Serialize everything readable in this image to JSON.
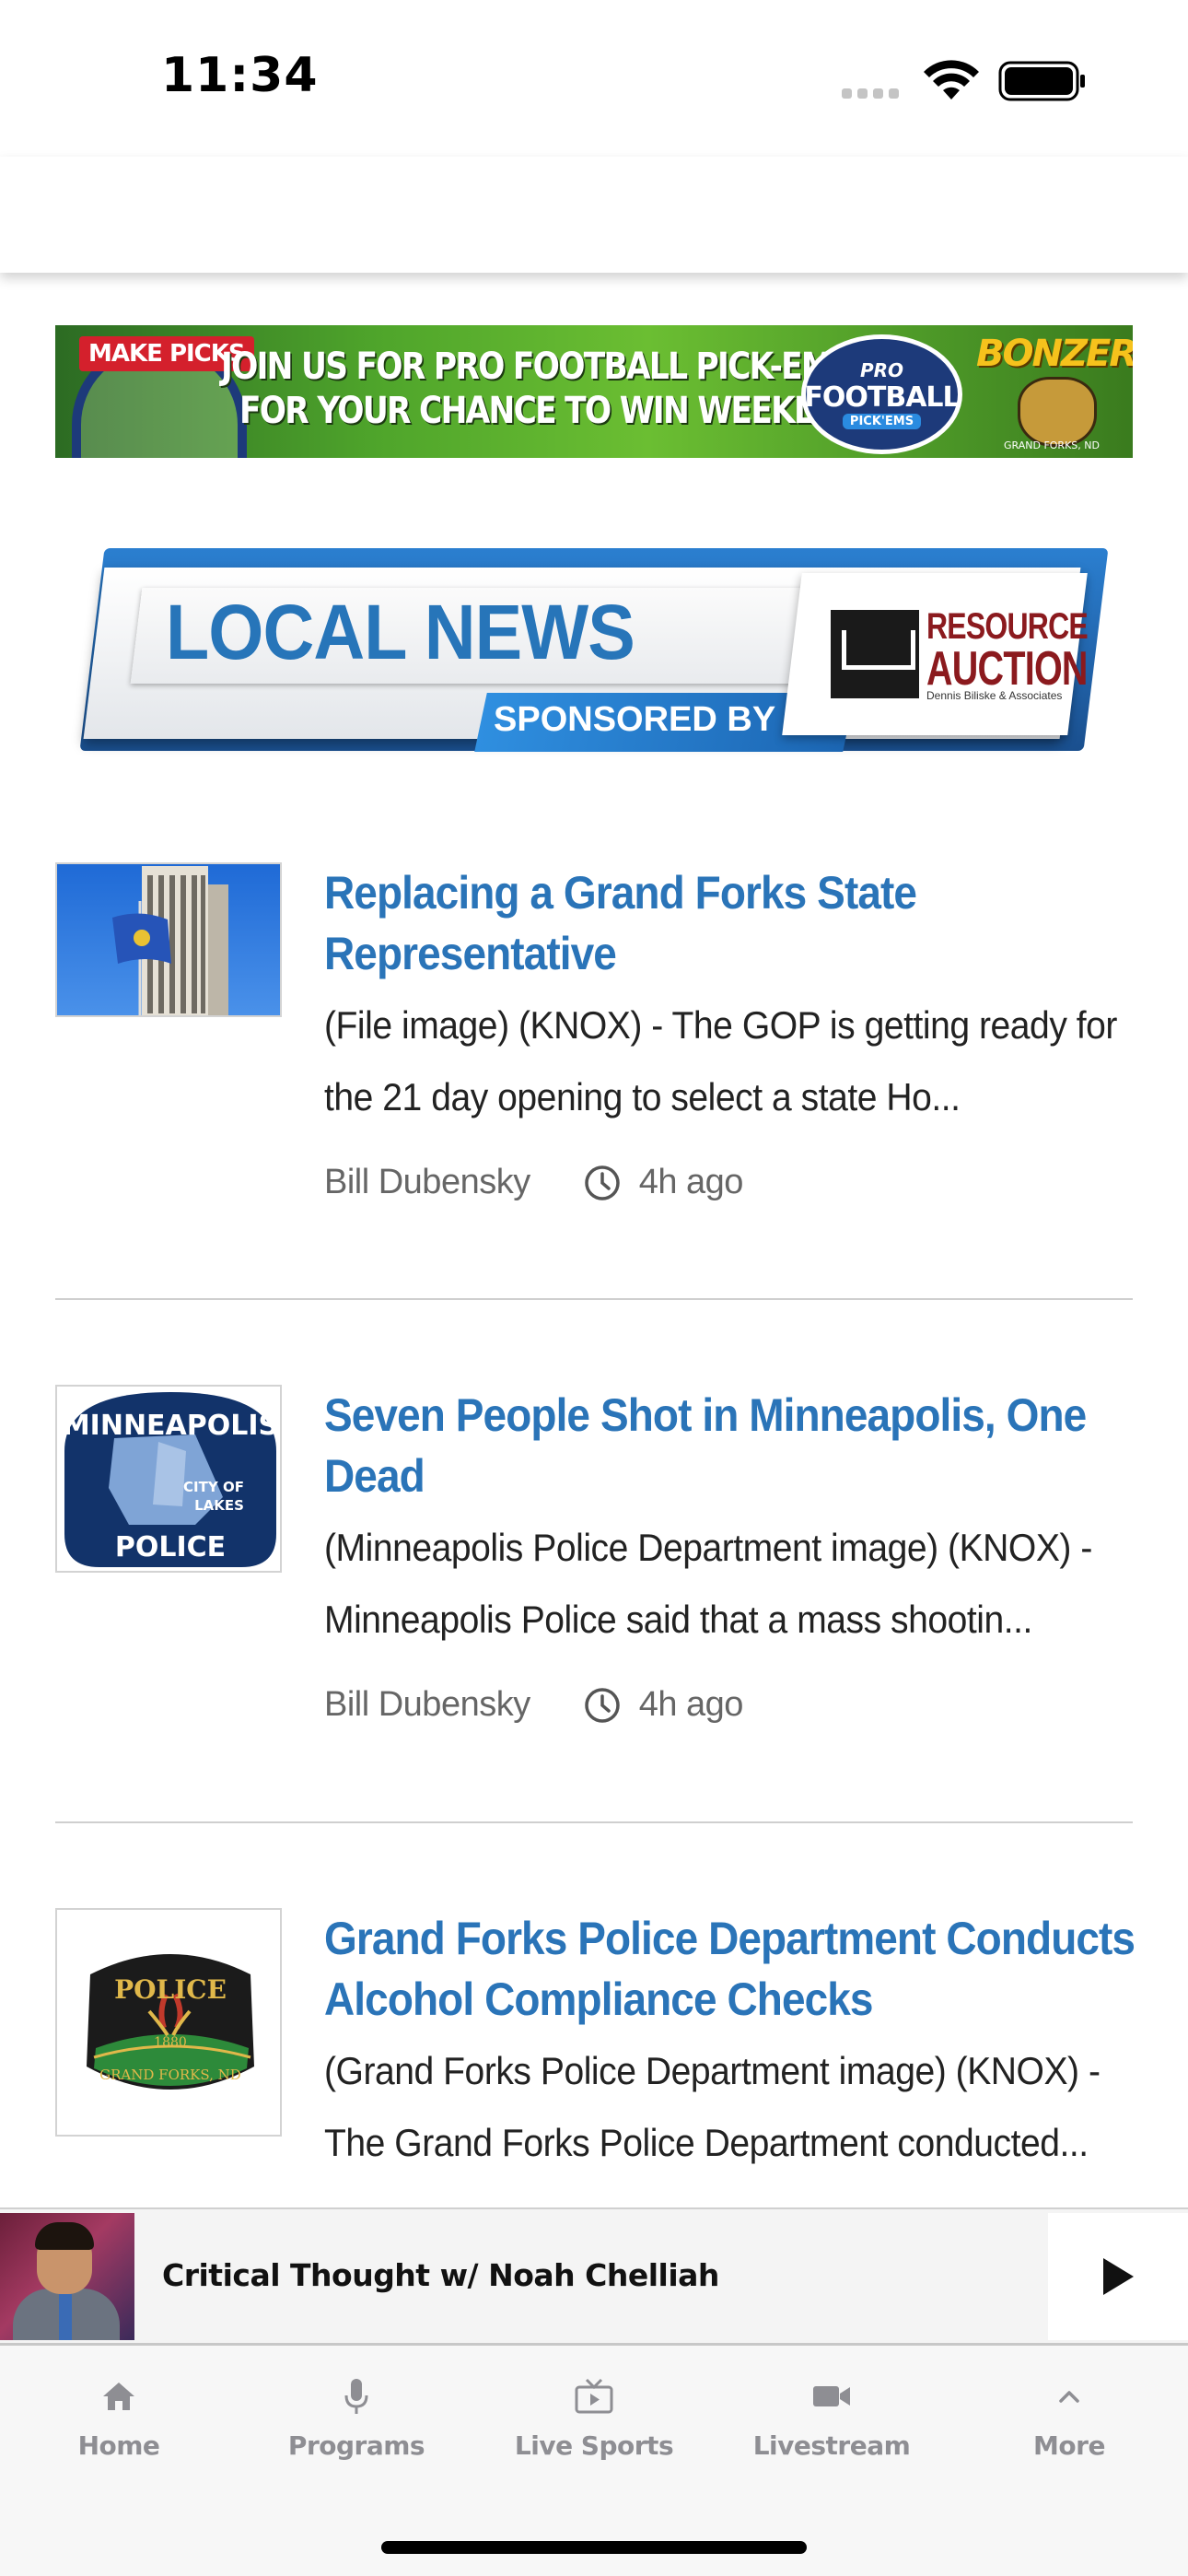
{
  "status_bar": {
    "time": "11:34"
  },
  "ad": {
    "badge": "MAKE PICKS",
    "line1": "JOIN US FOR PRO FOOTBALL PICK-EMS",
    "line2": "FOR YOUR CHANCE TO WIN WEEKLY!",
    "logo_top": "PRO",
    "logo_main": "FOOTBALL",
    "logo_sub": "PICK'EMS",
    "sponsor": "BONZERS",
    "sponsor_town": "GRAND FORKS, ND"
  },
  "news_banner": {
    "title": "LOCAL NEWS",
    "sponsored_by": "SPONSORED BY",
    "sponsor_line1": "RESOURCE",
    "sponsor_line2": "AUCTION",
    "sponsor_tagline": "Dennis Biliske & Associates"
  },
  "articles": [
    {
      "headline": "Replacing a Grand Forks State Representative",
      "excerpt": "(File image) (KNOX) - The GOP is getting ready for the 21 day opening to select a state Ho...",
      "author": "Bill Dubensky",
      "time": "4h ago",
      "thumb": "flag-building"
    },
    {
      "headline": "Seven People Shot in Minneapolis, One Dead",
      "excerpt": "(Minneapolis Police Department image) (KNOX) - Minneapolis Police said that a mass shootin...",
      "author": "Bill Dubensky",
      "time": "4h ago",
      "thumb": "minneapolis-police-badge",
      "badge_top": "MINNEAPOLIS",
      "badge_mid1": "CITY OF",
      "badge_mid2": "LAKES",
      "badge_bottom": "POLICE"
    },
    {
      "headline": "Grand Forks Police Department Conducts Alcohol Compliance Checks",
      "excerpt": "(Grand Forks Police Department image) (KNOX) - The Grand Forks Police Department conducted...",
      "thumb": "grand-forks-police-badge",
      "badge_top": "POLICE",
      "badge_year": "1880",
      "badge_bottom": "GRAND FORKS, ND"
    }
  ],
  "player": {
    "title": "Critical Thought w/ Noah Chelliah"
  },
  "tabs": [
    {
      "label": "Home",
      "icon": "home-icon"
    },
    {
      "label": "Programs",
      "icon": "microphone-icon"
    },
    {
      "label": "Live Sports",
      "icon": "tv-icon"
    },
    {
      "label": "Livestream",
      "icon": "video-camera-icon"
    },
    {
      "label": "More",
      "icon": "chevron-up-icon"
    }
  ],
  "colors": {
    "headline": "#2a74b8",
    "tab_inactive": "#8e8e93",
    "banner_blue": "#2775b9"
  }
}
